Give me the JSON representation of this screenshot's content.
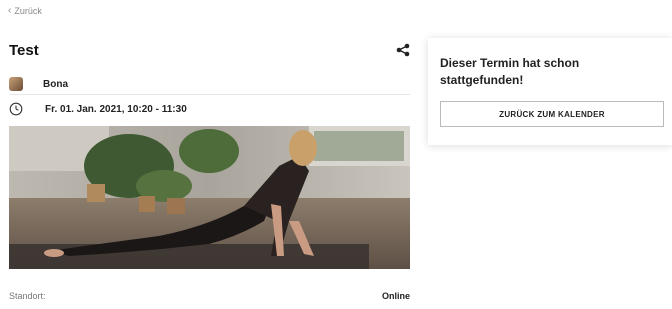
{
  "nav": {
    "back_icon": "chevron-left-icon",
    "back_label": "Zurück"
  },
  "event": {
    "title": "Test",
    "share_icon": "share-icon",
    "instructor": "Bona",
    "clock_icon": "clock-icon",
    "datetime": "Fr. 01. Jan. 2021, 10:20 - 11:30",
    "location_label": "Standort:",
    "location_value": "Online"
  },
  "notice": {
    "message": "Dieser Termin hat schon stattgefunden!",
    "button_label": "ZURÜCK ZUM KALENDER"
  }
}
